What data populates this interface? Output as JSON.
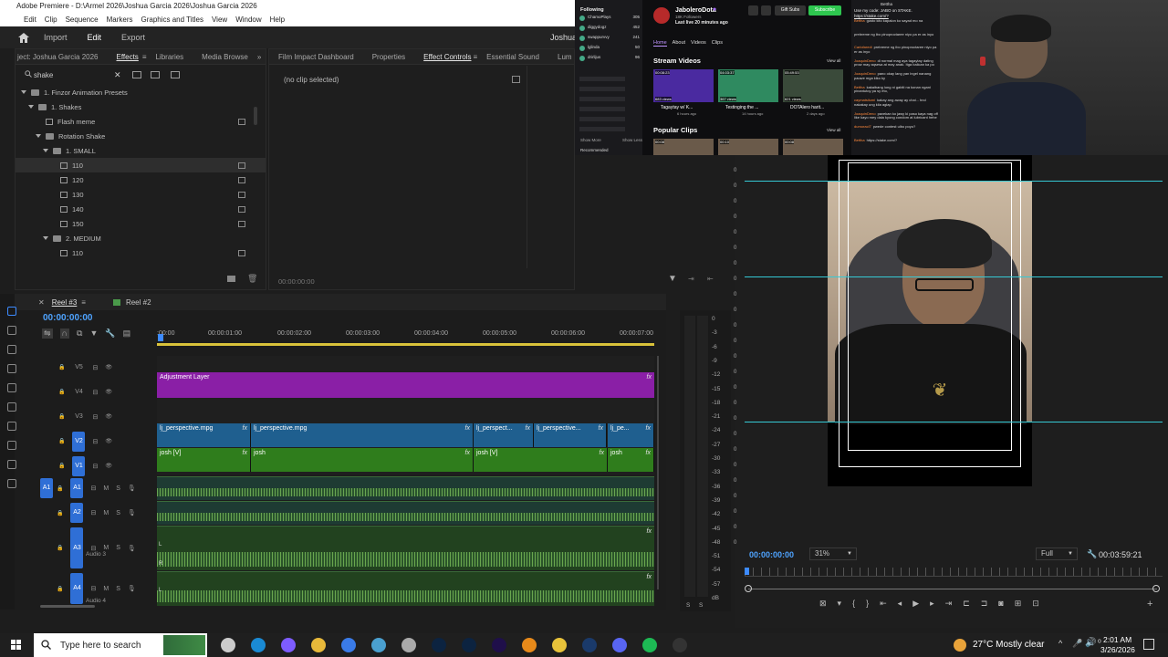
{
  "app": {
    "title": "Adobe Premiere - D:\\Armel 2026\\Joshua Garcia 2026\\Joshua Garcia 2026",
    "menu": [
      "Edit",
      "Clip",
      "Sequence",
      "Markers",
      "Graphics and Titles",
      "View",
      "Window",
      "Help"
    ],
    "workspace": {
      "items": [
        "Import",
        "Edit",
        "Export"
      ],
      "active": "Edit",
      "user": "Joshua"
    }
  },
  "effects_panel": {
    "project_label": "ject: Joshua Garcia 2026",
    "tabs": [
      "Effects",
      "Libraries",
      "Media Browse"
    ],
    "active_tab": "Effects",
    "search_value": "shake",
    "tree": [
      {
        "label": "1. Finzor Animation Presets",
        "depth": 0,
        "type": "folder"
      },
      {
        "label": "1. Shakes",
        "depth": 1,
        "type": "folder"
      },
      {
        "label": "Flash meme",
        "depth": 2,
        "type": "preset"
      },
      {
        "label": "Rotation Shake",
        "depth": 2,
        "type": "folder"
      },
      {
        "label": "1. SMALL",
        "depth": 3,
        "type": "folder"
      },
      {
        "label": "110",
        "depth": 4,
        "type": "preset",
        "selected": true
      },
      {
        "label": "120",
        "depth": 4,
        "type": "preset"
      },
      {
        "label": "130",
        "depth": 4,
        "type": "preset"
      },
      {
        "label": "140",
        "depth": 4,
        "type": "preset"
      },
      {
        "label": "150",
        "depth": 4,
        "type": "preset"
      },
      {
        "label": "2. MEDIUM",
        "depth": 3,
        "type": "folder"
      },
      {
        "label": "110",
        "depth": 4,
        "type": "preset"
      }
    ]
  },
  "effect_controls": {
    "tabs": [
      "Film Impact Dashboard",
      "Properties",
      "Effect Controls",
      "Essential Sound",
      "Lum"
    ],
    "active_tab": "Effect Controls",
    "empty_text": "(no clip selected)",
    "timecode": "00:00:00:00"
  },
  "timeline": {
    "tabs": [
      "Reel #3",
      "Reel #2"
    ],
    "timecode": "00:00:00:00",
    "ruler": [
      ":00:00",
      "00:00:01:00",
      "00:00:02:00",
      "00:00:03:00",
      "00:00:04:00",
      "00:00:05:00",
      "00:00:06:00",
      "00:00:07:00"
    ],
    "video_tracks": [
      "V5",
      "V4",
      "V3",
      "V2",
      "V1"
    ],
    "audio_tracks": [
      "A1",
      "A2",
      "A3",
      "A4"
    ],
    "audio_names": {
      "A3": "Audio 3",
      "A4": "Audio 4"
    },
    "adjustment_label": "Adjustment Layer",
    "v2_clips": [
      "lj_perspective.mpg",
      "lj_perspective.mpg",
      "lj_perspect...",
      "lj_perspective...",
      "lj_pe..."
    ],
    "v1_clips": [
      "josh [V]",
      "josh",
      "josh [V]",
      "josh"
    ],
    "fx_label": "fx",
    "m_label": "M",
    "s_label": "S",
    "r_label": "R",
    "l_label": "L"
  },
  "audio_meter": {
    "labels": [
      "0",
      "-3",
      "-6",
      "-9",
      "-12",
      "-15",
      "-18",
      "-21",
      "-24",
      "-27",
      "-30",
      "-33",
      "-36",
      "-39",
      "-42",
      "-45",
      "-48",
      "-51",
      "-54",
      "-57",
      "dB"
    ],
    "footer": [
      "S",
      "S"
    ]
  },
  "program_monitor": {
    "scale_labels": [
      "0",
      "0",
      "0",
      "0",
      "0",
      "0",
      "0",
      "0",
      "0",
      "0",
      "0",
      "0",
      "0",
      "0",
      "0",
      "0",
      "0",
      "0",
      "0",
      "0",
      "0",
      "0",
      "0",
      "0",
      "0"
    ],
    "timecode": "00:00:00:00",
    "zoom": "31%",
    "quality": "Full",
    "duration": "00:03:59:21"
  },
  "browser": {
    "channel": "JaboleroDota",
    "followers": "18K Followers",
    "live_status": "Last live 20 minutes ago",
    "buttons": [
      "Gift Subs",
      "Subscribe"
    ],
    "nav": [
      "Home",
      "About",
      "Videos",
      "Clips"
    ],
    "active_nav": "Home",
    "following_label": "Following",
    "following": [
      {
        "name": "ChamoPlays",
        "count": "305"
      },
      {
        "name": "diggydogz",
        "count": "452"
      },
      {
        "name": "swappurvvy",
        "count": "241"
      },
      {
        "name": "lglinda",
        "count": "50"
      },
      {
        "name": "drirlijus",
        "count": "96"
      }
    ],
    "show_more": "Show More",
    "show_less": "Show Less",
    "recommended": "Recommended",
    "stream_videos_label": "Stream Videos",
    "view_all": "View all",
    "videos": [
      {
        "title": "Tagaytay w/ K...",
        "views": "683 views",
        "duration": "00:08:23",
        "age": "6 hours ago"
      },
      {
        "title": "Testinging the ...",
        "views": "367 views",
        "duration": "04:03:37",
        "age": "14 hours ago"
      },
      {
        "title": "DOTAlero harit...",
        "views": "621 views",
        "duration": "05:49:53",
        "age": "2 days ago"
      }
    ],
    "popular_clips_label": "Popular Clips",
    "clip_durations": [
      "00:08",
      "00:10",
      "00:08"
    ]
  },
  "chat": {
    "header_name": "Bettha",
    "promo": "Use my code: JABO on STAKE.",
    "promo_link": "https://stake.com/?",
    "messages": [
      {
        "user": "Bettha",
        "text": "gusto kito kapalon ko sayad mo na"
      },
      {
        "user": "",
        "text": "prebreme ng ibo pinoproctaree niyo pa er as inyo"
      },
      {
        "user": "Carlofaredi",
        "text": "prebreme ng ibo pinoproctaree niyo pa er as inyo"
      },
      {
        "user": "JoaquinDeno",
        "text": "di normal mag aya tagaytay dating prow may aqsesa at may anak. Itga balican ka po"
      },
      {
        "user": "JoaquinDeno",
        "text": "pano okay lang yan lngel nanang pauwe mga kiko ky"
      },
      {
        "user": "Bettha",
        "text": "kakaibang long ni gabiti na konan ngani pinantutoy pa sy eto,"
      },
      {
        "user": "caymatsilumi",
        "text": "kakay ang away ay chai... hnd nakakay ung kila agiap"
      },
      {
        "user": "JoaquinDeno",
        "text": "pavekan ko jawy ki paso kaya nag off like kayo mey dala kyong condom at lubricant hehe"
      },
      {
        "user": "dumoracl7",
        "text": "pwede contest ulbo poyo?"
      },
      {
        "user": "Bettha",
        "text": "https://stake.com/?"
      }
    ]
  },
  "taskbar": {
    "search_placeholder": "Type here to search",
    "weather": "27°C  Mostly clear",
    "time": "2:01 AM",
    "date": "3/26/2026"
  }
}
